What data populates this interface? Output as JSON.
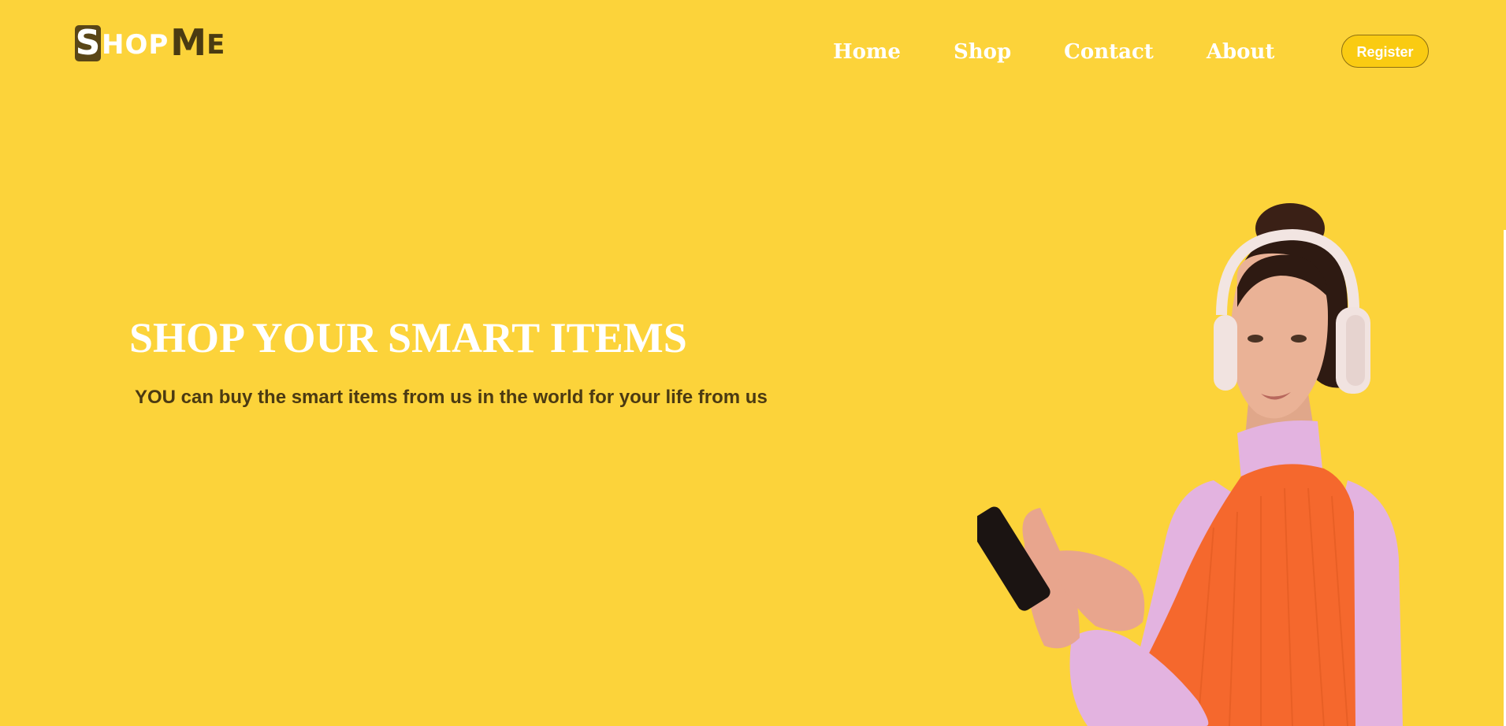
{
  "brand": {
    "logo_first_letter": "S",
    "logo_rest": "HOP",
    "logo_m": "M",
    "logo_e": "E"
  },
  "nav": {
    "items": [
      {
        "label": "Home"
      },
      {
        "label": "Shop"
      },
      {
        "label": "Contact"
      },
      {
        "label": "About"
      }
    ]
  },
  "register_label": "Register",
  "hero": {
    "title": "SHOP YOUR SMART ITEMS",
    "subtitle": "YOU can buy the smart items from us in the world for your life from us"
  },
  "colors": {
    "background": "#FCD33A",
    "accent_button": "#FACB12",
    "logo_dark": "#4a3b12",
    "subtitle_text": "#4b3a12"
  },
  "icons": [
    "person-with-headphones-image"
  ]
}
